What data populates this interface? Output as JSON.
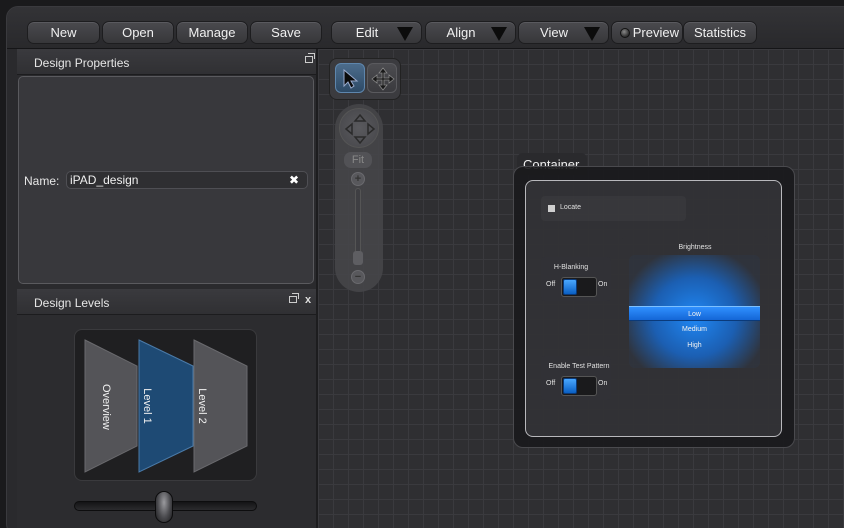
{
  "toolbar": {
    "new": "New",
    "open": "Open",
    "manage": "Manage",
    "save": "Save",
    "edit": "Edit",
    "align": "Align",
    "view": "View",
    "preview": "Preview",
    "statistics": "Statistics"
  },
  "design_properties": {
    "title": "Design Properties",
    "name_label": "Name:",
    "name_value": "iPAD_design"
  },
  "design_levels": {
    "title": "Design Levels",
    "close": "x",
    "levels": [
      "Overview",
      "Level 1",
      "Level 2"
    ],
    "selected_level": "Level 1"
  },
  "canvas_nav": {
    "fit_label": "Fit",
    "zoom_in": "+",
    "zoom_out": "−"
  },
  "container": {
    "title": "Container",
    "locate_label": "Locate",
    "hblanking": {
      "label": "H-Blanking",
      "off": "Off",
      "on": "On"
    },
    "test_pattern": {
      "label": "Enable Test Pattern",
      "off": "Off",
      "on": "On"
    },
    "brightness": {
      "label": "Brightness",
      "options": [
        "Low",
        "Medium",
        "High"
      ],
      "selected": "Low"
    }
  },
  "colors": {
    "accent_blue": "#1f7fe8",
    "selected_level": "#1e4a74"
  }
}
